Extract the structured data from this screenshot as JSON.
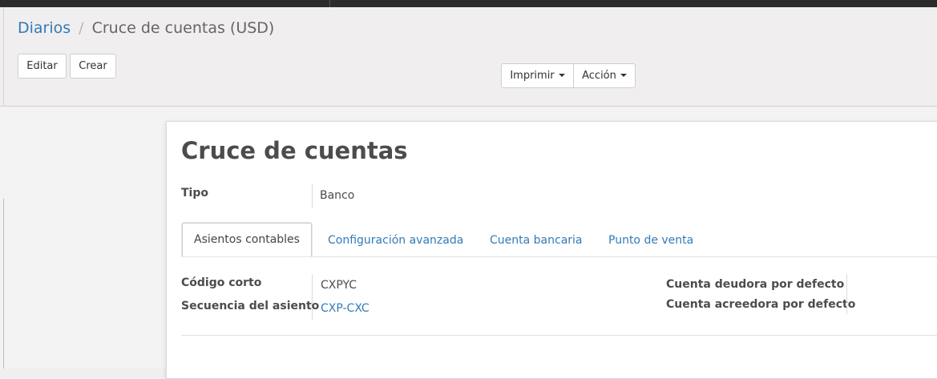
{
  "breadcrumb": {
    "parent": "Diarios",
    "separator": "/",
    "current": "Cruce de cuentas (USD)"
  },
  "toolbar": {
    "edit_label": "Editar",
    "create_label": "Crear",
    "print_label": "Imprimir",
    "action_label": "Acción"
  },
  "record": {
    "title": "Cruce de cuentas",
    "type_label": "Tipo",
    "type_value": "Banco"
  },
  "tabs": [
    {
      "label": "Asientos contables",
      "active": true
    },
    {
      "label": "Configuración avanzada",
      "active": false
    },
    {
      "label": "Cuenta bancaria",
      "active": false
    },
    {
      "label": "Punto de venta",
      "active": false
    }
  ],
  "fields": {
    "short_code_label": "Código corto",
    "short_code_value": "CXPYC",
    "sequence_label": "Secuencia del asiento",
    "sequence_value": "CXP-CXC",
    "default_debit_label": "Cuenta deudora por defecto",
    "default_credit_label": "Cuenta acreedora por defecto"
  },
  "colors": {
    "link": "#337ab7",
    "text": "#4c4c4c",
    "topbar": "#2b2b2b"
  }
}
